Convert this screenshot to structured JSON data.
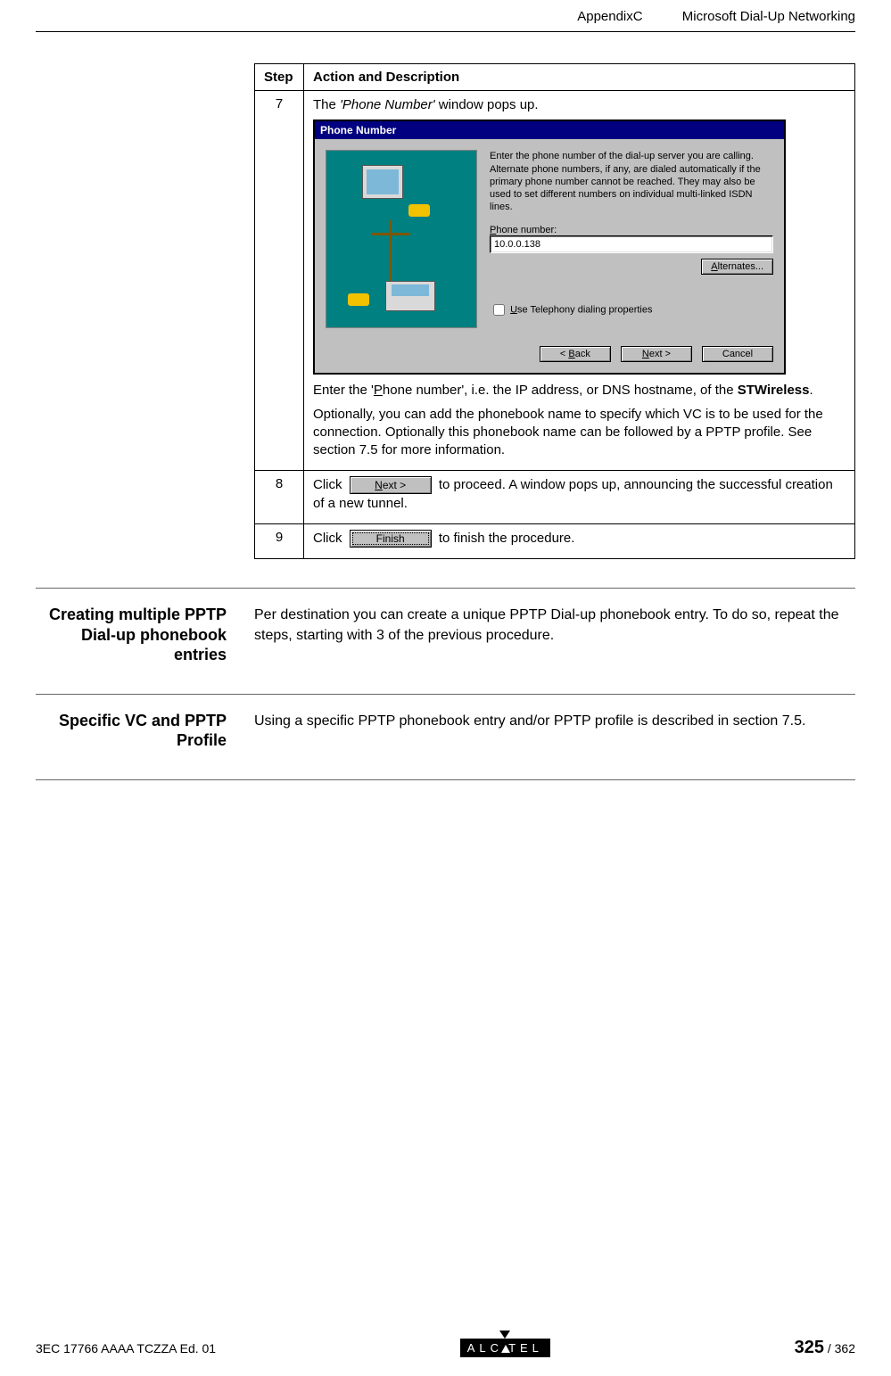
{
  "header": {
    "appendix": "AppendixC",
    "title": "Microsoft Dial-Up Networking"
  },
  "table": {
    "col_step": "Step",
    "col_action": "Action and Description",
    "rows": {
      "r7": {
        "num": "7",
        "line1_a": "The ",
        "line1_em": "'Phone Number'",
        "line1_b": " window pops up.",
        "win": {
          "title": "Phone Number",
          "blurb": "Enter the phone number of the dial-up server you are calling. Alternate phone numbers, if any, are dialed automatically if the primary phone number cannot be reached. They may also be used to set different numbers on individual multi-linked ISDN lines.",
          "phone_label_pre": "P",
          "phone_label_post": "hone number:",
          "phone_value": "10.0.0.138",
          "alternates": "Alternates...",
          "use_tele_u": "U",
          "use_tele_rest": "se Telephony dialing properties",
          "back": "< Back",
          "next": "Next >",
          "cancel": "Cancel"
        },
        "after1_a": "Enter the '",
        "after1_u": "P",
        "after1_b": "hone number', i.e. the IP address, or DNS hostname, of the ",
        "after1_bold": "STWireless",
        "after1_c": ".",
        "after2": "Optionally, you can add the phonebook name to specify which VC is to be used for the connection. Optionally this phonebook name can be followed by a PPTP profile. See section 7.5 for more information."
      },
      "r8": {
        "num": "8",
        "a": "Click",
        "btn_u": "N",
        "btn_rest": "ext >",
        "b": " to proceed. A window pops up, announcing the successful creation of a new tunnel."
      },
      "r9": {
        "num": "9",
        "a": "Click ",
        "btn": "Finish",
        "b": " to finish the procedure."
      }
    }
  },
  "sections": {
    "s1": {
      "heading": "Creating multiple PPTP Dial-up phonebook entries",
      "body": "Per destination you can create a unique PPTP Dial-up phonebook entry. To do so, repeat the steps, starting with 3 of the previous procedure."
    },
    "s2": {
      "heading": "Specific VC and PPTP Profile",
      "body": "Using a specific PPTP phonebook entry and/or PPTP profile is described in section 7.5."
    }
  },
  "footer": {
    "docref": "3EC 17766 AAAA TCZZA Ed. 01",
    "logo_a": "ALC",
    "logo_b": "TEL",
    "page_current": "325",
    "page_sep": " / ",
    "page_total": "362"
  }
}
